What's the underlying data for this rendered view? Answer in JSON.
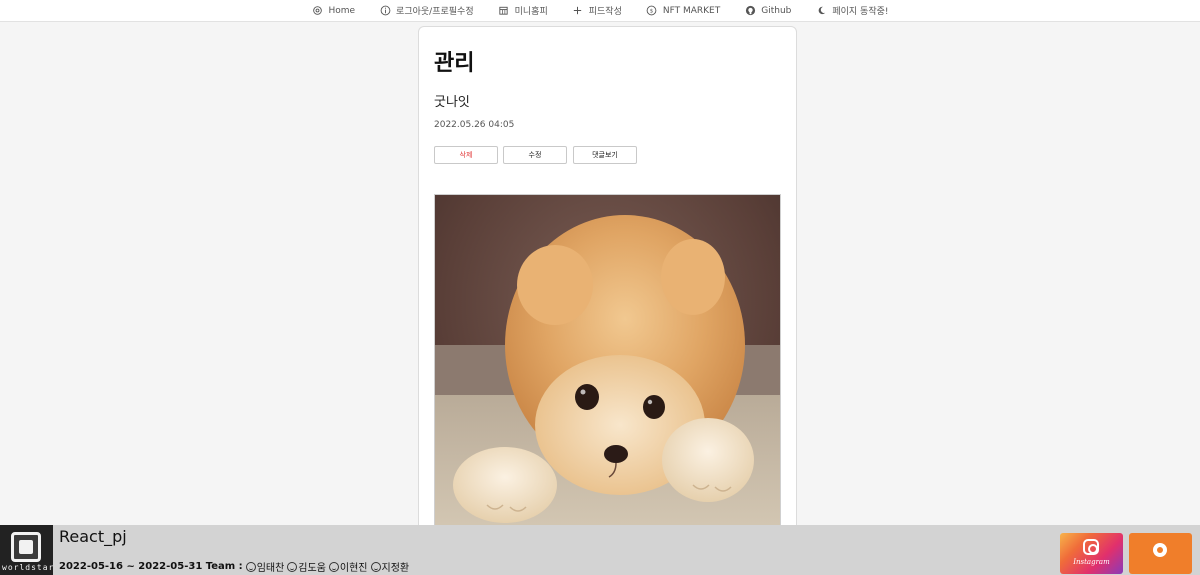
{
  "nav": {
    "items": [
      {
        "label": "Home",
        "icon": "settings-icon"
      },
      {
        "label": "로그아웃/프로필수정",
        "icon": "info-icon"
      },
      {
        "label": "미니홈피",
        "icon": "calendar-icon"
      },
      {
        "label": "피드작성",
        "icon": "plus-icon"
      },
      {
        "label": "NFT MARKET",
        "icon": "coin-icon"
      },
      {
        "label": "Github",
        "icon": "github-icon"
      },
      {
        "label": "페이지 동작중!",
        "icon": "moon-icon"
      }
    ]
  },
  "post": {
    "title": "관리",
    "body": "굿나잇",
    "date": "2022.05.26 04:05",
    "buttons": {
      "delete": "삭제",
      "edit": "수정",
      "comments": "댓글보기"
    },
    "image_alt": "pomeranian-puppy-photo"
  },
  "footer": {
    "logo_text": "worldstar",
    "title": "React_pj",
    "team_prefix": "2022-05-16 ~ 2022-05-31 Team :",
    "members": [
      "임태찬",
      "김도움",
      "이현진",
      "지정환"
    ],
    "instagram_label": "Instagram"
  },
  "colors": {
    "delete": "#e23a3a",
    "footer_bg": "#d3d3d3",
    "orange": "#f07e2a"
  }
}
